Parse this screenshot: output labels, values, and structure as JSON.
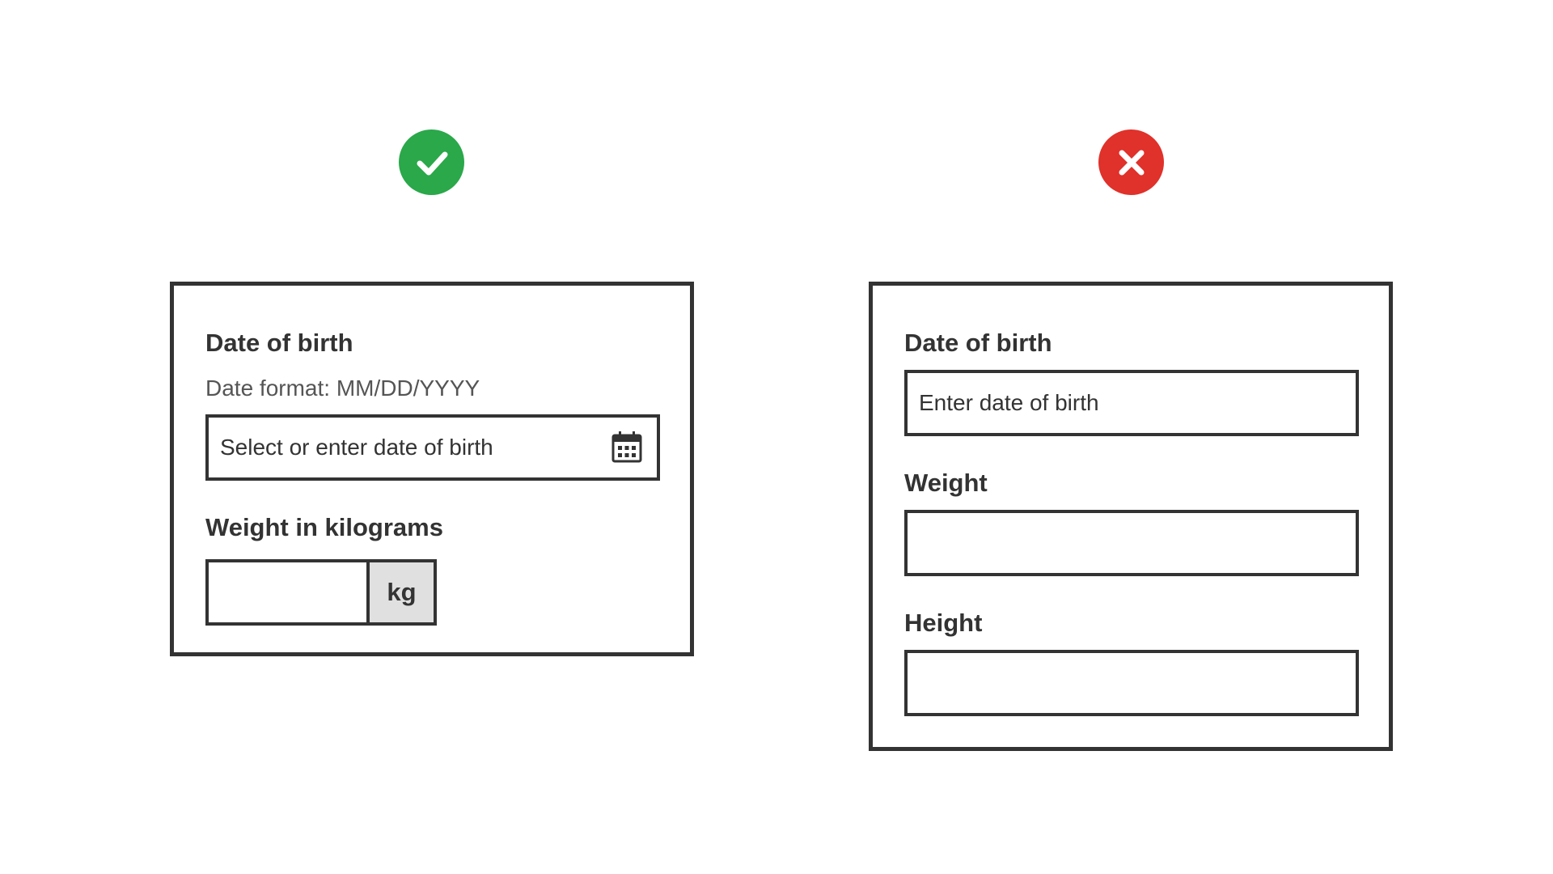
{
  "colors": {
    "good": "#2aa84a",
    "bad": "#e0312a",
    "border": "#333333",
    "addon_bg": "#e0e0e0"
  },
  "good_example": {
    "status_icon": "check-circle-icon",
    "dob_label": "Date of birth",
    "dob_hint": "Date format: MM/DD/YYYY",
    "dob_placeholder": "Select or enter date of birth",
    "dob_picker_icon": "calendar-icon",
    "weight_label": "Weight in kilograms",
    "weight_value": "",
    "weight_unit": "kg"
  },
  "bad_example": {
    "status_icon": "x-circle-icon",
    "dob_label": "Date of birth",
    "dob_placeholder": "Enter date of birth",
    "weight_label": "Weight",
    "weight_value": "",
    "height_label": "Height",
    "height_value": ""
  }
}
